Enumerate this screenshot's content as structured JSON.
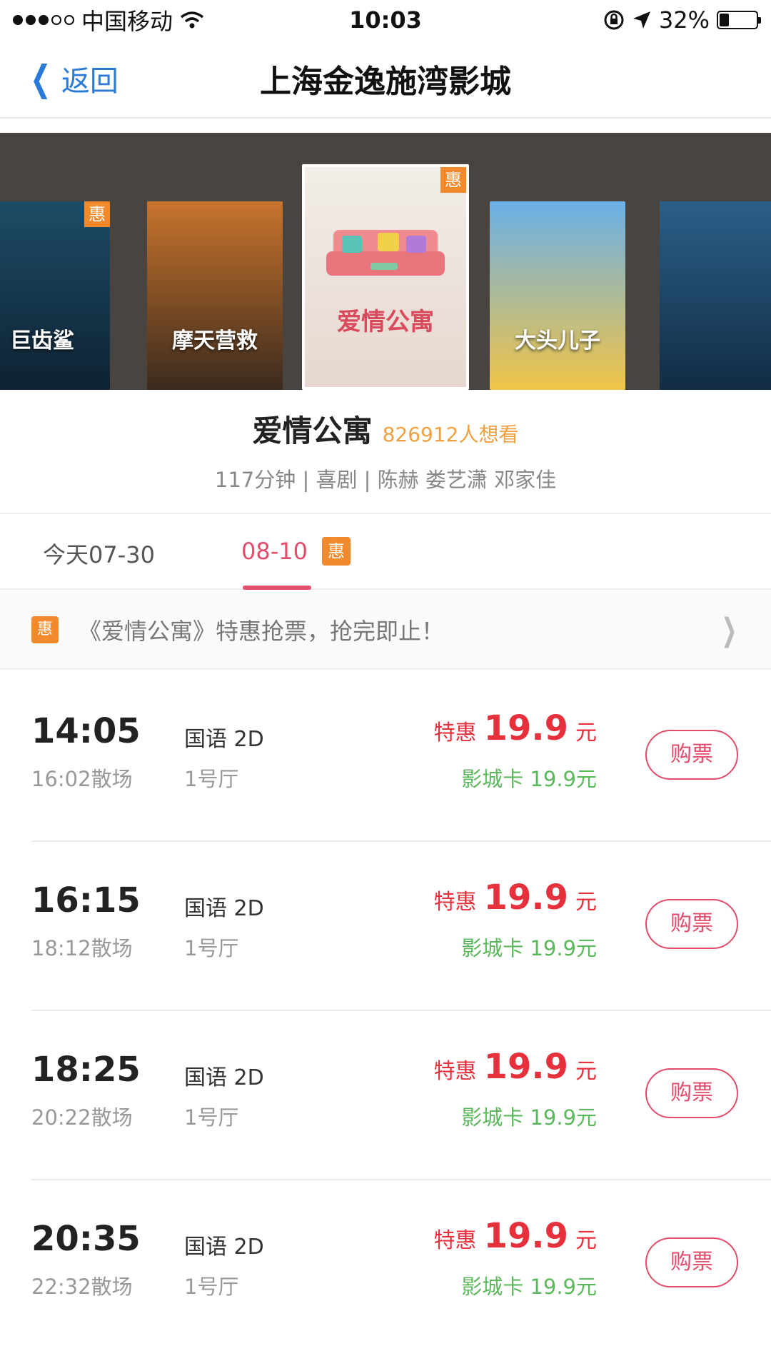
{
  "status_bar": {
    "carrier": "中国移动",
    "time": "10:03",
    "battery": "32%",
    "battery_level": 0.32
  },
  "nav": {
    "back_label": "返回",
    "title": "上海金逸施湾影城"
  },
  "carousel": {
    "posters": [
      {
        "title": "巨齿鲨",
        "badge": "惠",
        "colors": [
          "#1d4c66",
          "#0e2233"
        ]
      },
      {
        "title": "摩天营救",
        "badge": "",
        "colors": [
          "#c8742c",
          "#3b2a1e"
        ]
      },
      {
        "title": "爱情公寓",
        "badge": "惠",
        "colors": [
          "#f2ede8",
          "#e6d8d0"
        ]
      },
      {
        "title": "大头儿子",
        "badge": "",
        "colors": [
          "#6ab0e8",
          "#f1c447"
        ]
      },
      {
        "title": "",
        "badge": "",
        "colors": [
          "#2a5f88",
          "#122c44"
        ]
      }
    ]
  },
  "movie": {
    "name": "爱情公寓",
    "want_count": "826912人想看",
    "meta": "117分钟 | 喜剧 | 陈赫 娄艺潇 邓家佳"
  },
  "date_tabs": {
    "today": "今天07-30",
    "active": "08-10",
    "active_badge": "惠"
  },
  "promo": {
    "badge": "惠",
    "text": "《爱情公寓》特惠抢票，抢完即止！"
  },
  "showtimes": [
    {
      "start": "14:05",
      "end": "16:02散场",
      "lang": "国语 2D",
      "hall": "1号厅",
      "price_label": "特惠",
      "price": "19.9",
      "unit": "元",
      "card_price": "影城卡 19.9元",
      "buy": "购票"
    },
    {
      "start": "16:15",
      "end": "18:12散场",
      "lang": "国语 2D",
      "hall": "1号厅",
      "price_label": "特惠",
      "price": "19.9",
      "unit": "元",
      "card_price": "影城卡 19.9元",
      "buy": "购票"
    },
    {
      "start": "18:25",
      "end": "20:22散场",
      "lang": "国语 2D",
      "hall": "1号厅",
      "price_label": "特惠",
      "price": "19.9",
      "unit": "元",
      "card_price": "影城卡 19.9元",
      "buy": "购票"
    },
    {
      "start": "20:35",
      "end": "22:32散场",
      "lang": "国语 2D",
      "hall": "1号厅",
      "price_label": "特惠",
      "price": "19.9",
      "unit": "元",
      "card_price": "影城卡 19.9元",
      "buy": "购票"
    }
  ],
  "colors": {
    "accent": "#e34c6a",
    "price_red": "#e6303c",
    "card_green": "#5cb85c",
    "badge_orange": "#f08a2c",
    "link_blue": "#2a7ad9"
  }
}
